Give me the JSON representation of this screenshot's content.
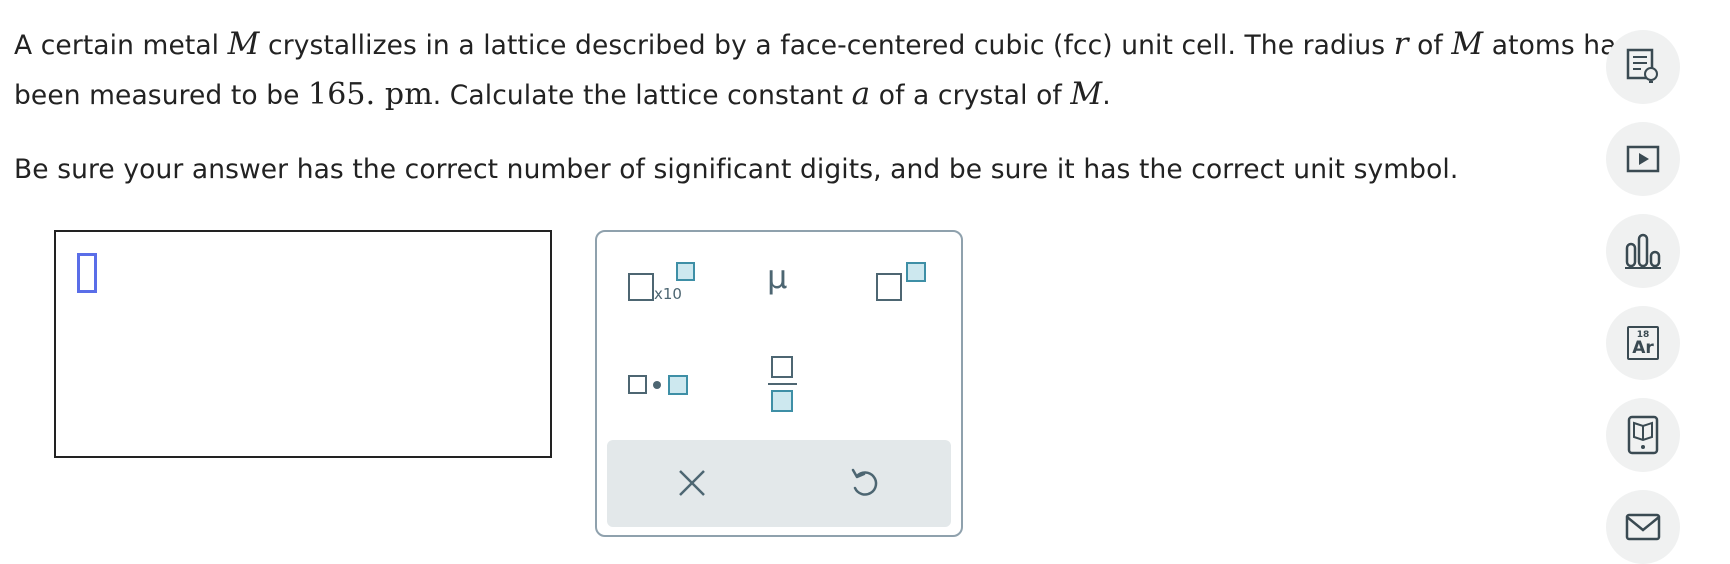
{
  "question": {
    "line1_part1": "A certain metal ",
    "var_M": "M",
    "line1_part2": " crystallizes in a lattice described by a face-centered cubic (fcc) unit cell. The radius ",
    "var_r": "r",
    "line1_part3": " of ",
    "line1_part4": " atoms has",
    "line2_part1": "been measured to be ",
    "radius_value": "165.",
    "radius_unit": "pm",
    "line2_part2": ". Calculate the lattice constant ",
    "var_a": "a",
    "line2_part3": " of a crystal of ",
    "line2_part4": ".",
    "instruction": "Be sure your answer has the correct number of significant digits, and be sure it has the correct unit symbol."
  },
  "answer": {
    "value": ""
  },
  "palette": {
    "sci_notation_label": "x10",
    "mu_symbol": "μ",
    "colors": {
      "icon": "#4d6672",
      "fill": "#cde8ef",
      "fill_stroke": "#3e8fa6"
    }
  },
  "sidebar": {
    "items": [
      {
        "name": "explanation-icon"
      },
      {
        "name": "video-icon"
      },
      {
        "name": "data-chart-icon"
      },
      {
        "name": "periodic-table-icon",
        "number": "18",
        "symbol": "Ar"
      },
      {
        "name": "textbook-icon"
      },
      {
        "name": "message-icon"
      }
    ]
  }
}
